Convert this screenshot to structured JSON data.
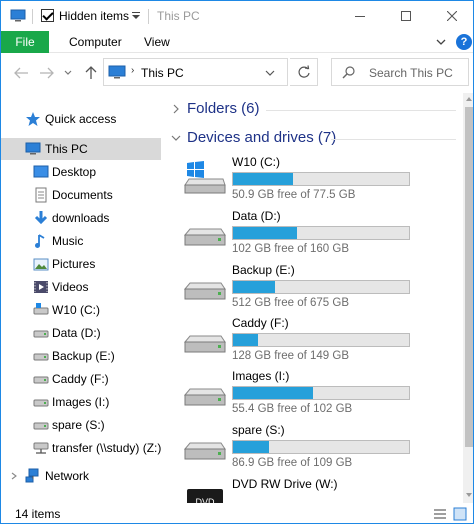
{
  "titlebar": {
    "hidden_items_label": "Hidden items",
    "title": "This PC"
  },
  "ribbon": {
    "tabs": [
      "File",
      "Computer",
      "View"
    ]
  },
  "address": {
    "path": "This PC",
    "search_placeholder": "Search This PC"
  },
  "sidebar": {
    "items": [
      {
        "label": "Quick access",
        "icon": "star-icon"
      },
      {
        "label": "This PC",
        "icon": "computer-icon"
      },
      {
        "label": "Desktop",
        "icon": "desktop-icon"
      },
      {
        "label": "Documents",
        "icon": "documents-icon"
      },
      {
        "label": "downloads",
        "icon": "download-icon"
      },
      {
        "label": "Music",
        "icon": "music-icon"
      },
      {
        "label": "Pictures",
        "icon": "pictures-icon"
      },
      {
        "label": "Videos",
        "icon": "videos-icon"
      },
      {
        "label": "W10 (C:)",
        "icon": "drive-icon"
      },
      {
        "label": "Data (D:)",
        "icon": "drive-icon"
      },
      {
        "label": "Backup (E:)",
        "icon": "drive-icon"
      },
      {
        "label": "Caddy (F:)",
        "icon": "drive-icon"
      },
      {
        "label": "Images (I:)",
        "icon": "drive-icon"
      },
      {
        "label": "spare (S:)",
        "icon": "drive-icon"
      },
      {
        "label": "transfer (\\\\study) (Z:)",
        "icon": "network-drive-icon"
      },
      {
        "label": "Network",
        "icon": "network-icon"
      }
    ]
  },
  "content": {
    "folders_group": "Folders (6)",
    "devices_group": "Devices and drives (7)",
    "drives": [
      {
        "name": "W10 (C:)",
        "free": "50.9 GB free of 77.5 GB",
        "used_fraction": 0.343
      },
      {
        "name": "Data (D:)",
        "free": "102 GB free of 160 GB",
        "used_fraction": 0.3625
      },
      {
        "name": "Backup (E:)",
        "free": "512 GB free of 675 GB",
        "used_fraction": 0.241
      },
      {
        "name": "Caddy (F:)",
        "free": "128 GB free of 149 GB",
        "used_fraction": 0.141
      },
      {
        "name": "Images (I:)",
        "free": "55.4 GB free of 102 GB",
        "used_fraction": 0.457
      },
      {
        "name": "spare (S:)",
        "free": "86.9 GB free of 109 GB",
        "used_fraction": 0.203
      },
      {
        "name": "DVD RW Drive (W:)",
        "free": "",
        "used_fraction": null
      }
    ]
  },
  "status": {
    "item_count": "14 items"
  },
  "colors": {
    "file_tab": "#19a84a",
    "drive_bar": "#26a0da",
    "group_heading": "#1e3287",
    "selection": "#d9d9d9"
  }
}
